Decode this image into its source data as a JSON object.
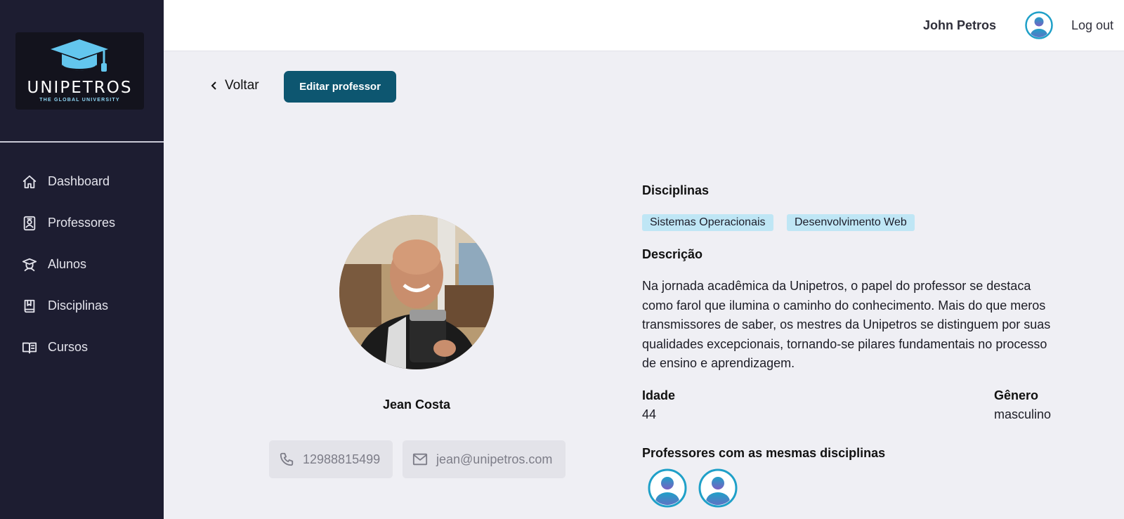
{
  "brand": {
    "name": "UNIPETROS",
    "tagline": "THE GLOBAL UNIVERSITY",
    "accent": "#63c6ee"
  },
  "sidebar": {
    "items": [
      {
        "label": "Dashboard",
        "icon": "home-icon"
      },
      {
        "label": "Professores",
        "icon": "teacher-badge-icon"
      },
      {
        "label": "Alunos",
        "icon": "student-icon"
      },
      {
        "label": "Disciplinas",
        "icon": "book-icon"
      },
      {
        "label": "Cursos",
        "icon": "open-book-icon"
      }
    ]
  },
  "header": {
    "user_name": "John Petros",
    "logout_label": "Log out"
  },
  "actions": {
    "back_label": "Voltar",
    "edit_label": "Editar professor"
  },
  "profile": {
    "name": "Jean Costa",
    "phone": "12988815499",
    "email": "jean@unipetros.com"
  },
  "details": {
    "disciplines_label": "Disciplinas",
    "disciplines": [
      "Sistemas Operacionais",
      "Desenvolvimento Web"
    ],
    "description_label": "Descrição",
    "description": "Na jornada acadêmica da Unipetros, o papel do professor se destaca como farol que ilumina o caminho do conhecimento. Mais do que meros transmissores de saber, os mestres da Unipetros se distinguem por suas qualidades excepcionais, tornando-se pilares fundamentais no processo de ensino e aprendizagem.",
    "age_label": "Idade",
    "age": "44",
    "gender_label": "Gênero",
    "gender": "masculino",
    "same_disciplines_label": "Professores com as mesmas disciplinas"
  },
  "colors": {
    "sidebar_bg": "#1d1d31",
    "primary_button": "#0d5670",
    "tag_bg": "#bfe6f5",
    "page_bg": "#efeff4"
  }
}
